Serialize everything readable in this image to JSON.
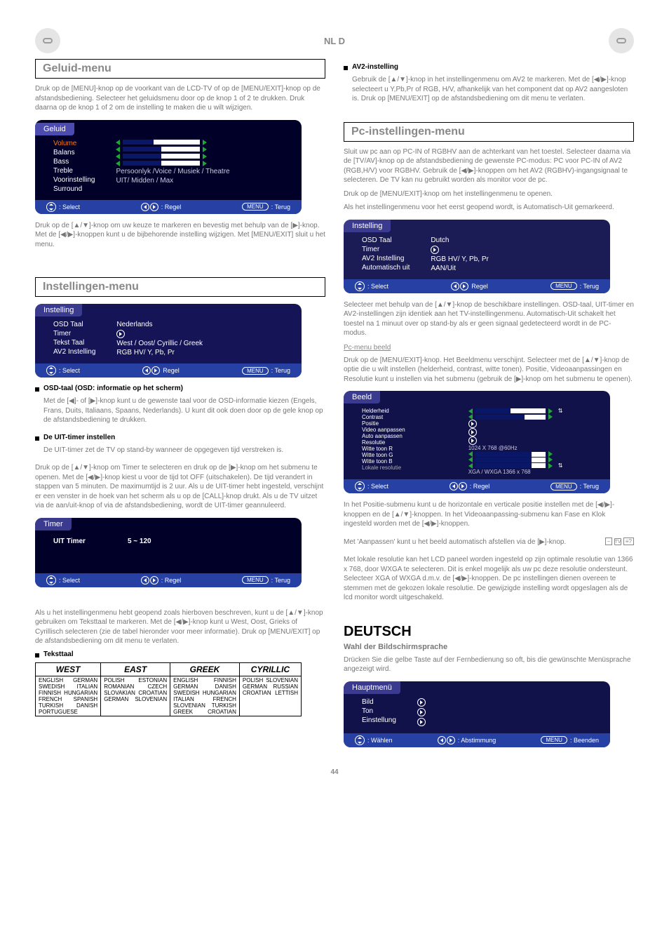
{
  "header": {
    "lang_badge": "NL D"
  },
  "left": {
    "sound_title": "Geluid-menu",
    "sound_menu": {
      "tab": "Geluid",
      "items": [
        "Volume",
        "Balans",
        "Bass",
        "Treble",
        "Voorinstelling",
        "Surround"
      ],
      "preset_val": "Persoonlyk  /Voice / Musiek / Theatre",
      "surround_val": "UIT/ Midden / Max",
      "footer": {
        "select": ": Select",
        "adjust": ": Regel",
        "back": ": Terug",
        "menu": "MENU"
      }
    },
    "sound_text1": "Druk op de [MENU]-knop op de voorkant van de LCD-TV of op de [MENU/EXIT]-knop op de afstandsbediening. Selecteer het geluidsmenu door op de knop 1 of 2 te drukken. Druk daarna op de knop 1 of 2 om de instelling te maken die u wilt wijzigen.",
    "sound_text2": "Druk op de [▲/▼]-knop om uw keuze te markeren en bevestig met behulp van de [▶]-knop. Met de [◀/▶]-knoppen kunt u de bijbehorende instelling wijzigen. Met [MENU/EXIT] sluit u het menu.",
    "settings_title": "Instellingen-menu",
    "inst_menu": {
      "tab": "Instelling",
      "items": [
        "OSD Taal",
        "Timer",
        "Tekst Taal",
        "AV2 Instelling"
      ],
      "osd_val": "Nederlands",
      "tekst_val": "West / Oost/ Cyrillic / Greek",
      "av2_val": "RGB HV/ Y, Pb, Pr",
      "footer": {
        "select": ": Select",
        "adjust": "Regel",
        "back": ": Terug",
        "menu": "MENU"
      }
    },
    "b1_bold": "OSD-taal (OSD: informatie op het scherm)",
    "b1_text": "Met de [◀]- of [▶]-knop kunt u de gewenste taal voor de OSD-informatie kiezen (Engels, Frans, Duits, Italiaans, Spaans, Nederlands). U kunt dit ook doen door op de gele knop op de afstandsbediening te drukken.",
    "b2_bold": "De UIT-timer instellen",
    "b2_text1": "De UIT-timer zet de TV op stand-by wanneer de opgegeven tijd verstreken is.",
    "b2_text2": "Druk op de [▲/▼]-knop om Timer te selecteren en druk op de [▶]-knop om het submenu te openen. Met de [◀/▶]-knop kiest u voor de tijd tot OFF (uitschakelen). De tijd verandert in stappen van 5 minuten. De maximumtijd is 2 uur. Als u de UIT-timer hebt ingesteld, verschijnt er een venster in de hoek van het scherm als u op de [CALL]-knop drukt. Als u de TV uitzet via de aan/uit-knop of via de afstandsbediening, wordt de UIT-timer geannuleerd.",
    "timer": {
      "tab": "Timer",
      "row_l": "UIT Timer",
      "row_r": "5 ~ 120",
      "footer": {
        "select": ": Select",
        "adjust": ": Regel",
        "back": ": Terug",
        "menu": "MENU"
      }
    },
    "tekst_text": "Als u het instellingenmenu hebt geopend zoals hierboven beschreven, kunt u de [▲/▼]-knop gebruiken om Teksttaal te markeren. Met de [◀/▶]-knop kunt u West, Oost, Grieks of Cyrillisch selecteren (zie de tabel hieronder voor meer informatie). Druk op [MENU/EXIT] op de afstandsbediening om dit menu te verlaten.",
    "b3_bold": "Teksttaal",
    "lang": {
      "h1": "WEST",
      "h2": "EAST",
      "h3": "GREEK",
      "h4": "CYRILLIC",
      "west": [
        [
          "ENGLISH",
          "GERMAN"
        ],
        [
          "SWEDISH",
          "ITALIAN"
        ],
        [
          "FINNISH",
          "HUNGARIAN"
        ],
        [
          "FRENCH",
          "SPANISH"
        ],
        [
          "TURKISH",
          "DANISH"
        ],
        [
          "PORTUGUESE",
          ""
        ]
      ],
      "east": [
        [
          "POLISH",
          "ESTONIAN"
        ],
        [
          "ROMANIAN",
          "CZECH"
        ],
        [
          "SLOVAKIAN",
          "CROATIAN"
        ],
        [
          "GERMAN",
          "SLOVENIAN"
        ]
      ],
      "greek": [
        [
          "ENGLISH",
          "FINNISH"
        ],
        [
          "GERMAN",
          "DANISH"
        ],
        [
          "SWEDISH",
          "HUNGARIAN"
        ],
        [
          "ITALIAN",
          "FRENCH"
        ],
        [
          "SLOVENIAN",
          "TURKISH"
        ],
        [
          "GREEK",
          "CROATIAN"
        ]
      ],
      "cyr": [
        [
          "POLISH",
          "SLOVENIAN"
        ],
        [
          "GERMAN",
          "RUSSIAN"
        ],
        [
          "CROATIAN",
          "LETTISH"
        ]
      ]
    }
  },
  "right": {
    "b_av2_bold": "AV2-instelling",
    "b_av2_text": "Gebruik de [▲/▼]-knop in het instellingenmenu om AV2 te markeren. Met de [◀/▶]-knop selecteert u Y,Pb,Pr of RGB, H/V, afhankelijk van het component dat op AV2 aangesloten is. Druk op [MENU/EXIT] op de afstandsbediening om dit menu te verlaten.",
    "pc_settings_title": "Pc-instellingen-menu",
    "pc_text1": "Sluit uw pc aan op PC-IN of RGBHV aan de achterkant van het toestel. Selecteer daarna via de [TV/AV]-knop op de afstandsbediening de gewenste PC-modus: PC voor PC-IN of AV2 (RGB,H/V) voor RGBHV. Gebruik de [◀/▶]-knoppen om het AV2 (RGBHV)-ingangsignaal te selecteren. De TV kan nu gebruikt worden als monitor voor de pc.",
    "pc_text2": "Druk op de [MENU/EXIT]-knop om het instellingenmenu te openen.",
    "pc_text3": "Als het instellingenmenu voor het eerst geopend wordt, is Automatisch-Uit gemarkeerd.",
    "inst_menu2": {
      "tab": "Instelling",
      "items": [
        "OSD Taal",
        "Timer",
        "AV2 Instelling",
        "Automatisch uit"
      ],
      "vals": [
        "Dutch",
        "",
        "RGB HV/ Y, Pb, Pr",
        "AAN/Uit"
      ],
      "footer": {
        "select": ": Select",
        "adjust": "Regel",
        "back": ": Terug",
        "menu": "MENU"
      }
    },
    "pc_text4": "Selecteer met behulp van de [▲/▼]-knop de beschikbare instellingen. OSD-taal, UIT-timer en AV2-instellingen zijn identiek aan het TV-instellingenmenu. Automatisch-Uit schakelt het toestel na 1 minuut over op stand-by als er geen signaal gedetecteerd wordt in de PC-modus.",
    "pc_pic_title": "Pc-menu beeld",
    "pc_pic_text1": "Druk op de [MENU/EXIT]-knop. Het Beeldmenu verschijnt. Selecteer met de [▲/▼]-knop de optie die u wilt instellen (helderheid, contrast, witte tonen). Positie, Videoaanpassingen en Resolutie kunt u instellen via het submenu (gebruik de [▶]-knop om het submenu te openen).",
    "beeld_menu": {
      "tab": "Beeld",
      "items": [
        "Helderheid",
        "Contrast",
        "Positie",
        "Video aanpassen",
        "Auto aanpassen",
        "Resolutie",
        "Witte toon R",
        "Witte toon G",
        "Witte toon B",
        "Lokale resolutie"
      ],
      "res_val": "1024 X 768        @60Hz",
      "lokale_val": "XGA / WXGA 1366 x 768",
      "footer": {
        "select": ": Select",
        "adjust": ": Regel",
        "back": ": Terug",
        "menu": "MENU"
      }
    },
    "pc_pic_text2": "In het Positie-submenu kunt u de horizontale en verticale positie instellen met de [◀/▶]-knoppen en de [▲/▼]-knoppen. In het Videoaanpassing-submenu kan Fase en Klok ingesteld worden met de [◀/▶]-knoppen.",
    "pc_pic_text3": "Met 'Aanpassen' kunt u het beeld automatisch afstellen via de [▶]-knop.",
    "remote_icons": [
      "–",
      "TV",
      "≡?"
    ],
    "pc_pic_text4": "Met lokale resolutie kan het LCD paneel worden ingesteld op zijn optimale resolutie van 1366 x 768, door WXGA te selecteren. Dit is enkel mogelijk als uw pc deze resolutie ondersteunt. Selecteer XGA of WXGA d.m.v. de [◀/▶]-knoppen. De pc instellingen dienen overeen te stemmen met de gekozen lokale resolutie. De gewijzigde instelling wordt opgeslagen als de lcd monitor wordt uitgeschakeld.",
    "deut": {
      "head": "DEUTSCH",
      "sub": "Wahl der Bildschirmsprache",
      "text": "Drücken Sie die gelbe Taste auf der Fernbedienung so oft, bis die gewünschte Menüsprache angezeigt wird.",
      "menu": {
        "tab": "Hauptmenü",
        "items": [
          "Bild",
          "Ton",
          "Einstellung"
        ],
        "footer": {
          "select": ": Wählen",
          "adjust": ": Abstimmung",
          "back": ": Beenden",
          "menu": "MENU"
        }
      }
    }
  },
  "page_num": "44"
}
